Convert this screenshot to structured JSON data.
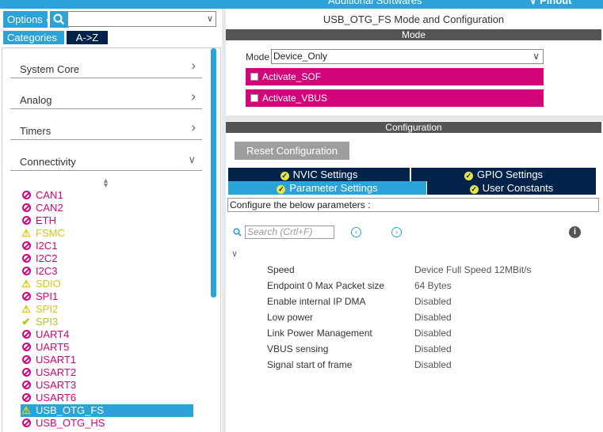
{
  "top_bar": {
    "additional_software": "Additional Softwares",
    "pinout": "Pinout"
  },
  "left": {
    "options_label": "Options",
    "search_value": "",
    "tabs": {
      "categories": "Categories",
      "az": "A->Z"
    },
    "categories": [
      {
        "label": "System Core",
        "chevron": ">"
      },
      {
        "label": "Analog",
        "chevron": ">"
      },
      {
        "label": "Timers",
        "chevron": ">"
      },
      {
        "label": "Connectivity",
        "chevron": "v"
      }
    ],
    "peripherals": [
      {
        "label": "CAN1",
        "status": "forbid"
      },
      {
        "label": "CAN2",
        "status": "forbid"
      },
      {
        "label": "ETH",
        "status": "forbid"
      },
      {
        "label": "FSMC",
        "status": "warn"
      },
      {
        "label": "I2C1",
        "status": "forbid"
      },
      {
        "label": "I2C2",
        "status": "forbid"
      },
      {
        "label": "I2C3",
        "status": "forbid"
      },
      {
        "label": "SDIO",
        "status": "warn"
      },
      {
        "label": "SPI1",
        "status": "forbid"
      },
      {
        "label": "SPI2",
        "status": "warn"
      },
      {
        "label": "SPI3",
        "status": "ok"
      },
      {
        "label": "UART4",
        "status": "forbid"
      },
      {
        "label": "UART5",
        "status": "forbid"
      },
      {
        "label": "USART1",
        "status": "forbid"
      },
      {
        "label": "USART2",
        "status": "forbid"
      },
      {
        "label": "USART3",
        "status": "forbid"
      },
      {
        "label": "USART6",
        "status": "forbid"
      },
      {
        "label": "USB_OTG_FS",
        "status": "warn",
        "selected": true
      },
      {
        "label": "USB_OTG_HS",
        "status": "forbid"
      }
    ]
  },
  "right": {
    "title": "USB_OTG_FS Mode and Configuration",
    "mode_header": "Mode",
    "mode_label": "Mode",
    "mode_value": "Device_Only",
    "checkboxes": [
      {
        "label": "Activate_SOF",
        "checked": false
      },
      {
        "label": "Activate_VBUS",
        "checked": false
      }
    ],
    "config_header": "Configuration",
    "reset_label": "Reset Configuration",
    "tabs": {
      "nvic": "NVIC Settings",
      "gpio": "GPIO Settings",
      "params": "Parameter Settings",
      "user": "User Constants"
    },
    "description": "Configure the below parameters :",
    "search_placeholder": "Search (Crtl+F)",
    "params": [
      {
        "name": "Speed",
        "value": "Device Full Speed 12MBit/s"
      },
      {
        "name": "Endpoint 0 Max Packet size",
        "value": "64 Bytes"
      },
      {
        "name": "Enable internal IP DMA",
        "value": "Disabled"
      },
      {
        "name": "Low power",
        "value": "Disabled"
      },
      {
        "name": "Link Power Management",
        "value": "Disabled"
      },
      {
        "name": "VBUS sensing",
        "value": "Disabled"
      },
      {
        "name": "Signal start of frame",
        "value": "Disabled"
      }
    ]
  },
  "colors": {
    "accent": "#2aa3d8",
    "dark_navy": "#03234b",
    "magenta": "#d1047a",
    "warning": "#d4c51c"
  }
}
